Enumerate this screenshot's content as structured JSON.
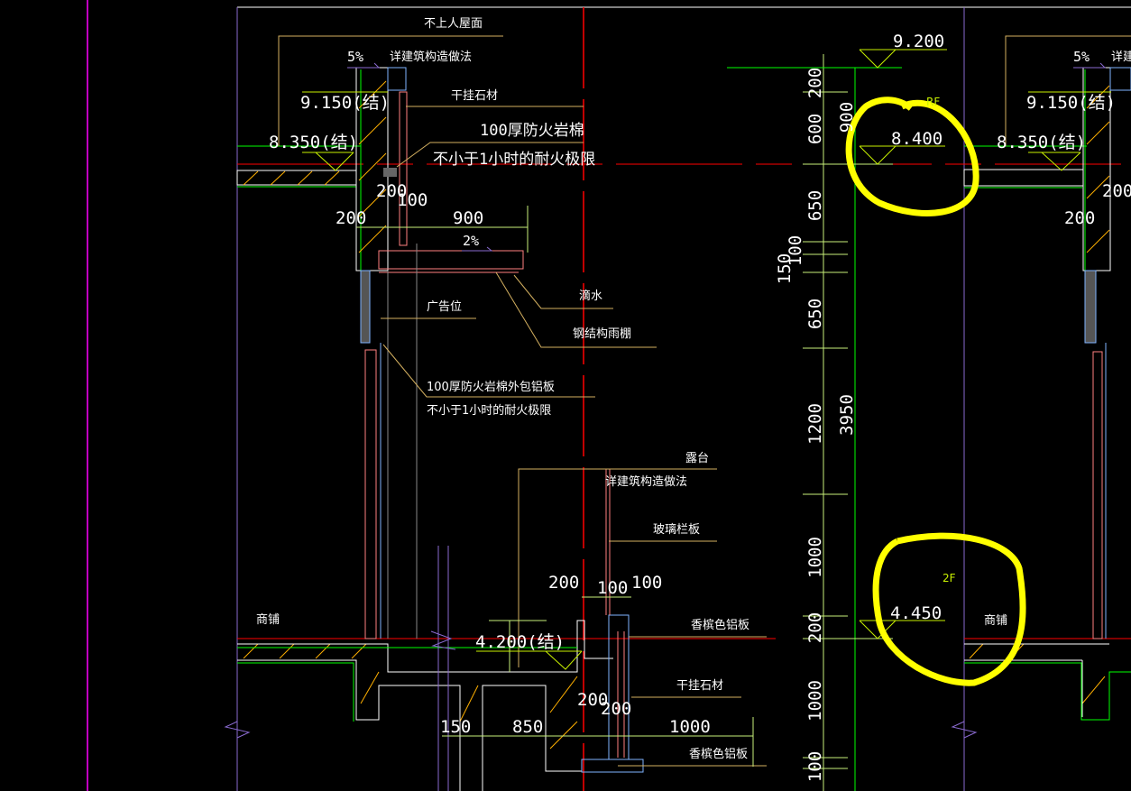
{
  "view": {
    "background": "#000000",
    "accent_colors": {
      "axis": "#ff0000",
      "wall": "#ffffff",
      "dimension": "#c8f07a",
      "finish": "#ff8080",
      "glass": "#80b4ff",
      "leader": "#d4b060",
      "green": "#00ff00",
      "annotation": "#ffff00",
      "hatch": "#ffb000"
    }
  },
  "annotations": {
    "roof_nonaccessible": "不上人屋面",
    "see_construction_left": "详建筑构造做法",
    "see_construction_right": "详建",
    "dry_hang_stone_top": "干挂石材",
    "rockwool_line1": "100厚防火岩棉",
    "rockwool_line2": "不小于1小时的耐火极限",
    "drip": "滴水",
    "steel_canopy": "钢结构雨棚",
    "ad_position": "广告位",
    "rockwool_al_line1": "100厚防火岩棉外包铝板",
    "rockwool_al_line2": "不小于1小时的耐火极限",
    "terrace": "露台",
    "see_construction_mid": "详建筑构造做法",
    "glass_railing": "玻璃栏板",
    "champagne_al_upper": "香槟色铝板",
    "dry_hang_stone_bottom": "干挂石材",
    "champagne_al_lower": "香槟色铝板",
    "shop_left": "商铺",
    "shop_right": "商铺"
  },
  "elevations": {
    "top": "9.200",
    "rf": "8.400",
    "rf_label": "RF",
    "f2": "4.450",
    "f2_label": "2F",
    "parapet_struct_left": "9.150(结)",
    "roof_struct_left": "8.350(结)",
    "parapet_struct_right": "9.150(结)",
    "roof_struct_right": "8.350(结)",
    "terrace_struct": "4.200(结)"
  },
  "slopes": {
    "roof_left": "5%",
    "roof_right": "5%",
    "canopy": "2%"
  },
  "dimensions": {
    "vertical_chain": [
      "200",
      "600",
      "650",
      "100",
      "150",
      "650",
      "1200",
      "1000",
      "200",
      "1000",
      "100"
    ],
    "vertical_total_upper": "900",
    "vertical_total": "3950",
    "left_detail": [
      "200",
      "200",
      "100",
      "900"
    ],
    "right_detail": [
      "200",
      "200"
    ],
    "terrace_detail": [
      "200",
      "100",
      "100",
      "200",
      "200",
      "150",
      "850",
      "1000"
    ]
  },
  "markup": {
    "circle_color": "#ffff00"
  }
}
